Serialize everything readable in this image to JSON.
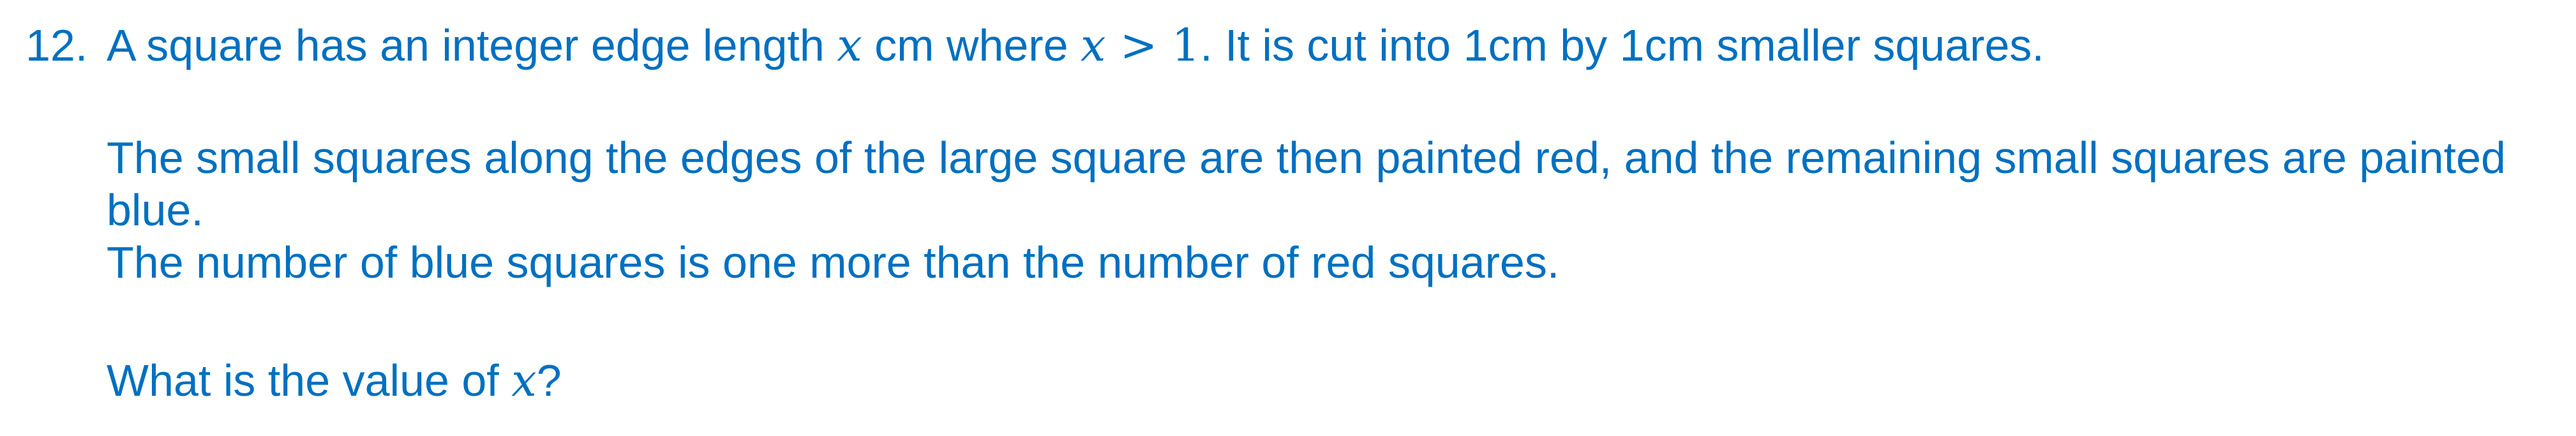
{
  "question": {
    "number": "12.",
    "line1_a": "A square has an integer edge length ",
    "var": "x",
    "line1_b": " cm where ",
    "gt": " > 1",
    "line1_c": ". It is cut into 1cm by 1cm smaller squares.",
    "para2": "The small squares along the edges of the large square are then painted red, and the remaining small squares are painted blue.",
    "para3": "The number of blue squares is one more than the number of red squares.",
    "prompt_a": "What is the value of ",
    "prompt_b": "?"
  }
}
